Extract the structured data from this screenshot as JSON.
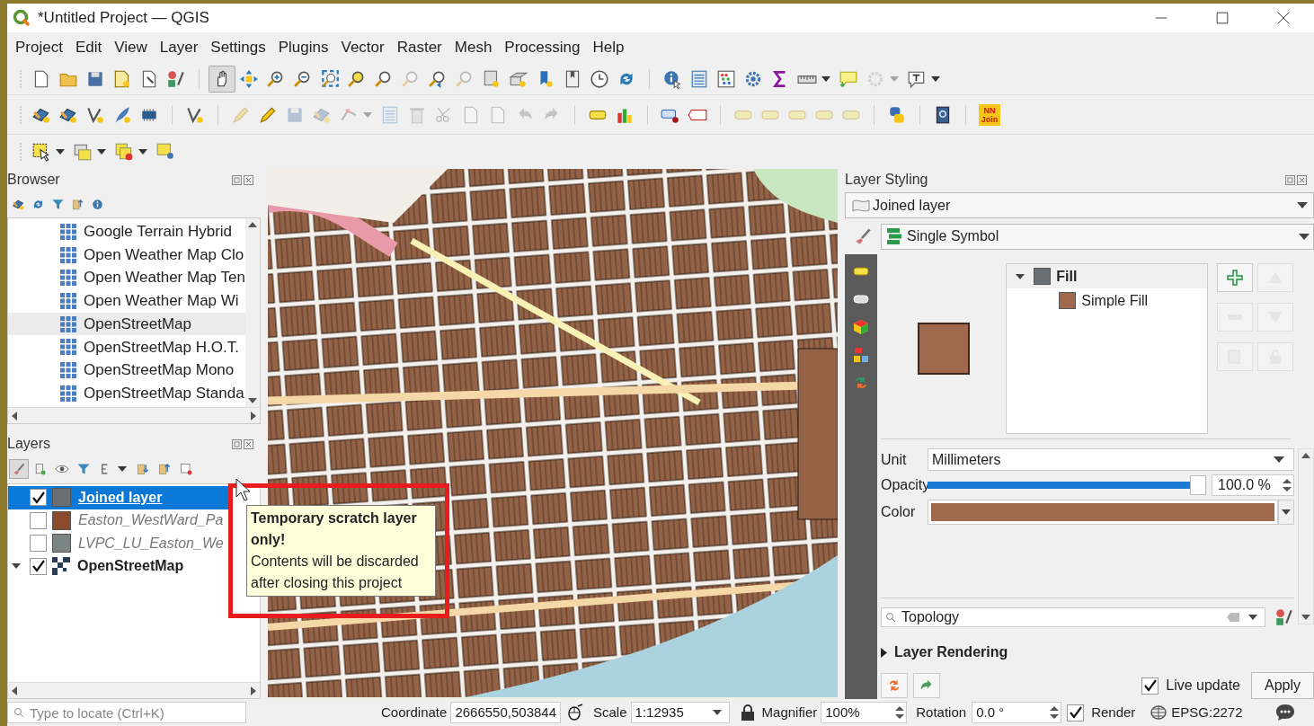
{
  "window": {
    "title": "*Untitled Project — QGIS"
  },
  "menu": [
    {
      "label": "Project"
    },
    {
      "label": "Edit"
    },
    {
      "label": "View"
    },
    {
      "label": "Layer"
    },
    {
      "label": "Settings"
    },
    {
      "label": "Plugins"
    },
    {
      "label": "Vector"
    },
    {
      "label": "Raster"
    },
    {
      "label": "Mesh"
    },
    {
      "label": "Processing"
    },
    {
      "label": "Help"
    }
  ],
  "toolbars": [
    [
      {
        "kind": "new-file",
        "disabled": false,
        "pressed": false
      },
      {
        "kind": "folder",
        "disabled": false,
        "pressed": false
      },
      {
        "kind": "save",
        "disabled": false,
        "pressed": false
      },
      {
        "kind": "new-layout",
        "disabled": false,
        "pressed": false
      },
      {
        "kind": "layout-manager",
        "disabled": false,
        "pressed": false
      },
      {
        "kind": "style-manager",
        "disabled": false,
        "pressed": false
      },
      {
        "kind": "separator"
      },
      {
        "kind": "pan",
        "disabled": false,
        "pressed": true
      },
      {
        "kind": "pan-to-selection",
        "disabled": false,
        "pressed": false
      },
      {
        "kind": "zoom-in",
        "disabled": false,
        "pressed": false
      },
      {
        "kind": "zoom-out",
        "disabled": false,
        "pressed": false
      },
      {
        "kind": "zoom-full",
        "disabled": false,
        "pressed": false
      },
      {
        "kind": "zoom-selection",
        "disabled": false,
        "pressed": false
      },
      {
        "kind": "zoom-layer",
        "disabled": false,
        "pressed": false
      },
      {
        "kind": "zoom-native",
        "disabled": true,
        "pressed": false
      },
      {
        "kind": "zoom-last",
        "disabled": false,
        "pressed": false
      },
      {
        "kind": "zoom-next",
        "disabled": true,
        "pressed": false
      },
      {
        "kind": "new-map-view",
        "disabled": false,
        "pressed": false
      },
      {
        "kind": "new-3d-view",
        "disabled": false,
        "pressed": false
      },
      {
        "kind": "bookmark",
        "disabled": false,
        "pressed": false
      },
      {
        "kind": "bookmarks",
        "disabled": false,
        "pressed": false
      },
      {
        "kind": "clock",
        "disabled": false,
        "pressed": false
      },
      {
        "kind": "refresh",
        "disabled": false,
        "pressed": false
      },
      {
        "kind": "separator"
      },
      {
        "kind": "identify",
        "disabled": false,
        "pressed": false
      },
      {
        "kind": "attribute-table",
        "disabled": false,
        "pressed": false
      },
      {
        "kind": "field-calculator",
        "disabled": false,
        "pressed": false
      },
      {
        "kind": "gear",
        "disabled": false,
        "pressed": false
      },
      {
        "kind": "sigma",
        "disabled": false,
        "pressed": false
      },
      {
        "kind": "ruler",
        "disabled": false,
        "pressed": false
      },
      {
        "kind": "caret",
        "disabled": false
      },
      {
        "kind": "annotation",
        "disabled": false,
        "pressed": false
      },
      {
        "kind": "locator",
        "disabled": true,
        "pressed": false
      },
      {
        "kind": "caret",
        "disabled": true
      },
      {
        "kind": "text-annotation",
        "disabled": false,
        "pressed": false
      },
      {
        "kind": "caret",
        "disabled": false
      }
    ],
    [
      {
        "kind": "add-layer",
        "disabled": false
      },
      {
        "kind": "add-layer",
        "disabled": false
      },
      {
        "kind": "add-vector",
        "disabled": false
      },
      {
        "kind": "feather",
        "disabled": false
      },
      {
        "kind": "chip",
        "disabled": false
      },
      {
        "kind": "separator"
      },
      {
        "kind": "add-vector",
        "disabled": false
      },
      {
        "kind": "separator"
      },
      {
        "kind": "pencil",
        "disabled": true
      },
      {
        "kind": "pencil",
        "disabled": false
      },
      {
        "kind": "save",
        "disabled": true
      },
      {
        "kind": "add-layer",
        "disabled": true
      },
      {
        "kind": "node",
        "disabled": true
      },
      {
        "kind": "caret",
        "disabled": true
      },
      {
        "kind": "attribute-table",
        "disabled": true
      },
      {
        "kind": "trash",
        "disabled": true
      },
      {
        "kind": "scissors",
        "disabled": true
      },
      {
        "kind": "new-file",
        "disabled": true
      },
      {
        "kind": "new-file",
        "disabled": true
      },
      {
        "kind": "undo",
        "disabled": true
      },
      {
        "kind": "redo",
        "disabled": true
      },
      {
        "kind": "separator"
      },
      {
        "kind": "label",
        "disabled": false
      },
      {
        "kind": "diagram",
        "disabled": false
      },
      {
        "kind": "separator"
      },
      {
        "kind": "label-pin",
        "disabled": false
      },
      {
        "kind": "label-red",
        "disabled": false
      },
      {
        "kind": "separator"
      },
      {
        "kind": "label",
        "disabled": true
      },
      {
        "kind": "label",
        "disabled": true
      },
      {
        "kind": "label",
        "disabled": true
      },
      {
        "kind": "label",
        "disabled": true
      },
      {
        "kind": "label",
        "disabled": true
      },
      {
        "kind": "separator"
      },
      {
        "kind": "python",
        "disabled": false
      },
      {
        "kind": "separator"
      },
      {
        "kind": "help",
        "disabled": false
      },
      {
        "kind": "separator"
      },
      {
        "kind": "plugin",
        "disabled": false,
        "label": "NN Join"
      }
    ],
    [
      {
        "kind": "select",
        "disabled": false
      },
      {
        "kind": "caret",
        "disabled": false
      },
      {
        "kind": "select-form",
        "disabled": false
      },
      {
        "kind": "caret",
        "disabled": false
      },
      {
        "kind": "deselect",
        "disabled": false
      },
      {
        "kind": "caret",
        "disabled": false
      },
      {
        "kind": "select-location",
        "disabled": false
      }
    ]
  ],
  "browser": {
    "title": "Browser",
    "tools": [
      {
        "kind": "add-layer"
      },
      {
        "kind": "refresh"
      },
      {
        "kind": "filter"
      },
      {
        "kind": "collapse"
      },
      {
        "kind": "info"
      }
    ],
    "items": [
      {
        "label": "Google Terrain Hybrid",
        "selected": false
      },
      {
        "label": "Open Weather Map Clo",
        "selected": false
      },
      {
        "label": "Open Weather Map Ten",
        "selected": false
      },
      {
        "label": "Open Weather Map Wi",
        "selected": false
      },
      {
        "label": "OpenStreetMap",
        "selected": true
      },
      {
        "label": "OpenStreetMap H.O.T.",
        "selected": false
      },
      {
        "label": "OpenStreetMap Mono",
        "selected": false
      },
      {
        "label": "OpenStreetMap Standa",
        "selected": false
      }
    ]
  },
  "layers": {
    "title": "Layers",
    "tools": [
      {
        "kind": "paintbrush"
      },
      {
        "kind": "add-group"
      },
      {
        "kind": "eye"
      },
      {
        "kind": "filter"
      },
      {
        "kind": "expression"
      },
      {
        "kind": "caret"
      },
      {
        "kind": "expand"
      },
      {
        "kind": "collapse"
      },
      {
        "kind": "remove-layer"
      }
    ],
    "items": [
      {
        "name": "Joined layer",
        "kind": "temporary",
        "checked": true,
        "selected": true,
        "color": "#6b6e75"
      },
      {
        "name": "Easton_WestWard_Pa",
        "kind": "vector",
        "checked": false,
        "selected": false,
        "color": "#8b4a2b"
      },
      {
        "name": "LVPC_LU_Easton_We",
        "kind": "vector",
        "checked": false,
        "selected": false,
        "color": "#7a8584"
      },
      {
        "name": "OpenStreetMap",
        "kind": "raster",
        "checked": true,
        "selected": false,
        "expanded": true
      }
    ]
  },
  "tooltip": {
    "title": "Temporary scratch layer only!",
    "body": "Contents will be discarded after closing this project"
  },
  "styling": {
    "title": "Layer Styling",
    "layer": "Joined layer",
    "renderer": "Single Symbol",
    "tabs": [
      {
        "kind": "label",
        "selected": false
      },
      {
        "kind": "label-outline",
        "selected": false
      },
      {
        "kind": "cube",
        "selected": false
      },
      {
        "kind": "form",
        "selected": false
      },
      {
        "kind": "join",
        "selected": false
      }
    ],
    "symbol_preview": {
      "color": "#a0694d"
    },
    "symbol_tree": [
      {
        "label": "Fill",
        "color": "#6b6e75",
        "expanded": true,
        "children": [
          {
            "label": "Simple Fill",
            "color": "#a0694d"
          }
        ]
      }
    ],
    "symbol_buttons": [
      {
        "kind": "add",
        "disabled": false
      },
      {
        "kind": "up",
        "disabled": true
      },
      {
        "kind": "remove",
        "disabled": true
      },
      {
        "kind": "down",
        "disabled": true
      },
      {
        "kind": "duplicate",
        "disabled": true
      },
      {
        "kind": "lock",
        "disabled": true
      }
    ],
    "unit_label": "Unit",
    "unit": "Millimeters",
    "opacity_label": "Opacity",
    "opacity": {
      "level": 1.0,
      "reading": "100.0 %"
    },
    "color_label": "Color",
    "color": "#a0694d",
    "search": {
      "value": "Topology"
    },
    "section": {
      "label": "Layer Rendering",
      "expanded": false
    },
    "live_update": {
      "label": "Live update",
      "checked": true
    },
    "apply": "Apply"
  },
  "status_bar": {
    "locate_placeholder": "Type to locate (Ctrl+K)",
    "coordinate_label": "Coordinate",
    "coordinate": "2666550,503844",
    "scale_label": "Scale",
    "scale": "1:12935",
    "magnifier_label": "Magnifier",
    "magnifier": "100%",
    "rotation_label": "Rotation",
    "rotation": "0.0 °",
    "render": {
      "label": "Render",
      "checked": true
    },
    "crs": "EPSG:2272"
  }
}
